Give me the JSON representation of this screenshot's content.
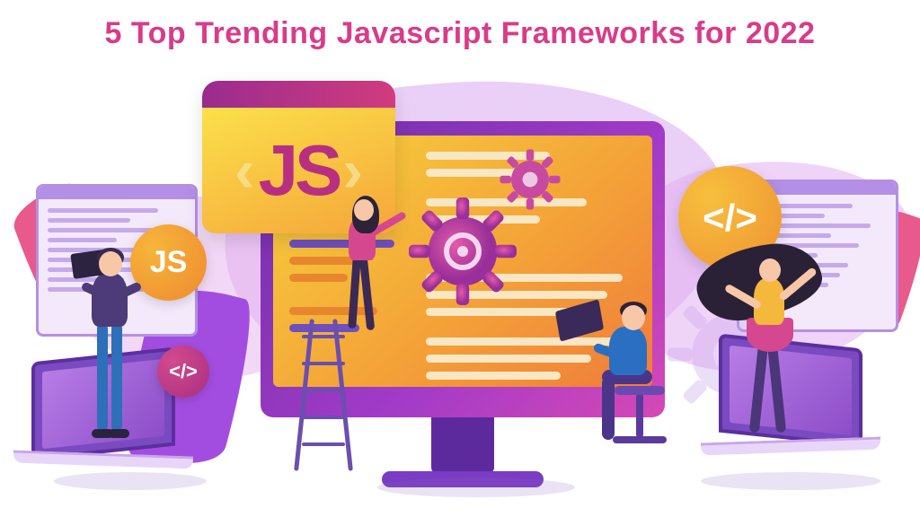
{
  "title": "5 Top Trending Javascript Frameworks for 2022",
  "js_card": {
    "left_angle": "‹",
    "text": "JS",
    "right_angle": "›"
  },
  "badges": {
    "js_small": "JS",
    "code_small": "</>",
    "code_big": "</>"
  },
  "colors": {
    "title": "#d93b8a",
    "accent_orange": "#f4a438",
    "accent_purple": "#8d4dc8",
    "accent_pink": "#d5478f"
  }
}
